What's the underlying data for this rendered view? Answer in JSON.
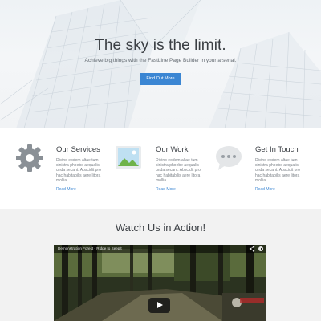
{
  "hero": {
    "title": "The sky is the limit.",
    "subtitle": "Achieve big things with the FastLine Page Builder in your arsenal.",
    "button_label": "Find Out More"
  },
  "features": [
    {
      "title": "Our Services",
      "icon": "gear-icon",
      "text": "Divino eodem altae tum sinistra phoebe aequalis unda secant. Abscidit pro hac habitabilis aere litora mollia.",
      "link": "Read More"
    },
    {
      "title": "Our Work",
      "icon": "image-icon",
      "text": "Divino eodem altae tum sinistra phoebe aequalis unda secant. Abscidit pro hac habitabilis aere litora mollia.",
      "link": "Read More"
    },
    {
      "title": "Get In Touch",
      "icon": "chat-bubble-icon",
      "text": "Divino eodem altae tum sinistra phoebe aequalis unda secant. Abscidit pro hac habitabilis aere litora mollia.",
      "link": "Read More"
    }
  ],
  "video": {
    "heading": "Watch Us in Action!",
    "title": "Demonstration Forest - Ridge to Seeplt",
    "share_icon": "share-icon",
    "info_icon": "info-icon",
    "play_icon": "play-icon"
  },
  "colors": {
    "accent": "#3b86d3",
    "heading": "#3b3f44",
    "body_text": "#7b8187",
    "section_gray": "#f2f2f2"
  }
}
